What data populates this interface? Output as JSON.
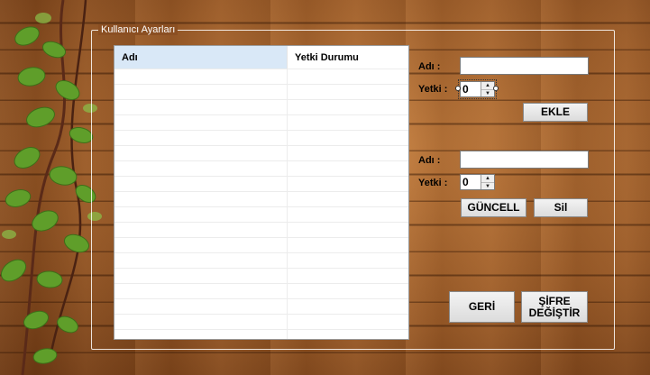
{
  "group": {
    "title": "Kullanıcı Ayarları"
  },
  "list": {
    "columns": [
      "Adı",
      "Yetki Durumu"
    ],
    "row_count": 18
  },
  "add_section": {
    "name_label": "Adı :",
    "name_value": "",
    "perm_label": "Yetki :",
    "perm_value": "0",
    "add_button": "EKLE"
  },
  "edit_section": {
    "name_label": "Adı :",
    "name_value": "",
    "perm_label": "Yetki :",
    "perm_value": "0",
    "update_button": "GÜNCELL",
    "delete_button": "Sil"
  },
  "footer": {
    "back_button": "GERİ",
    "change_password_line1": "ŞİFRE",
    "change_password_line2": "DEĞİŞTİR"
  },
  "icons": {
    "spin_up": "▲",
    "spin_down": "▼"
  }
}
